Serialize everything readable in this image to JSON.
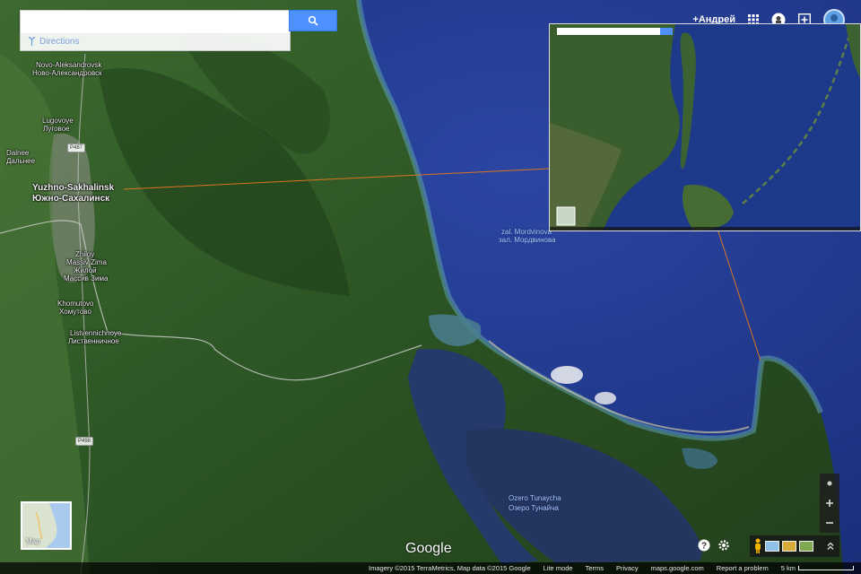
{
  "search": {
    "value": "",
    "placeholder": "",
    "directions_label": "Directions"
  },
  "topbar": {
    "user_name": "+Андрей"
  },
  "labels": {
    "novo_en": "Novo-Aleksandrovsk",
    "novo_ru": "Ново-Александровск",
    "lugovoye_en": "Lugovoye",
    "lugovoye_ru": "Луговое",
    "dalneye_en": "Dalnee",
    "dalneye_ru": "Дальнее",
    "ys_en": "Yuzhno-Sakhalinsk",
    "ys_ru": "Южно-Сахалинск",
    "zhiloy_en": "Zhiloy",
    "zhiloy_en2": "Massiv Zima",
    "zhiloy_ru": "Жилой",
    "zhiloy_ru2": "Массив Зима",
    "khomutovo_en": "Khomutovo",
    "khomutovo_ru": "Хомутово",
    "listv_en": "Listvennichnoye",
    "listv_ru": "Лиственничное",
    "mordvinova_en": "zal. Mordvinova",
    "mordvinova_ru": "зал. Мордвинова",
    "tunaycha_en": "Ozero Tunaycha",
    "tunaycha_ru": "Озеро Тунайча"
  },
  "road_shields": {
    "r1": "P487",
    "r2": "P498"
  },
  "minimap": {
    "label": "Map"
  },
  "google_logo": "Google",
  "footer": {
    "imagery": "Imagery ©2015 TerraMetrics, Map data ©2015 Google",
    "lite_mode": "Lite mode",
    "terms": "Terms",
    "privacy": "Privacy",
    "maps_url": "maps.google.com",
    "report": "Report a problem",
    "scale": "5 km"
  },
  "icons": {
    "search": "search-icon",
    "directions": "directions-icon",
    "apps": "apps-grid-icon",
    "notifications": "notifications-icon",
    "share": "share-plus-icon",
    "help": "help-icon",
    "settings": "gear-icon",
    "pegman": "pegman-icon",
    "expand": "expand-up-icon",
    "compass": "compass-icon"
  },
  "colors": {
    "search_button": "#4d90fe",
    "ocean": "#1e3a8c",
    "land": "#2f5a26",
    "pointer_line": "#d9751e"
  }
}
